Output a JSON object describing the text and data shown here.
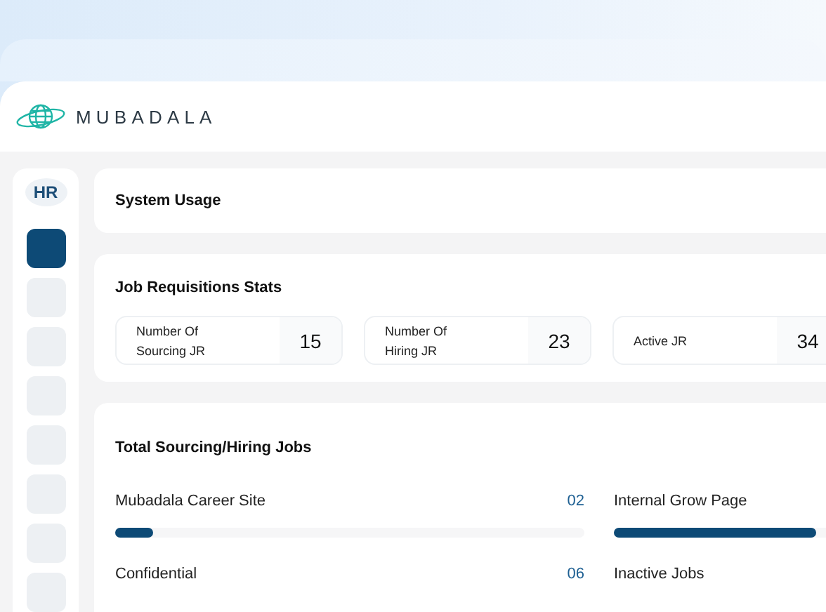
{
  "brand": {
    "name": "MUBADALA"
  },
  "sidebar": {
    "avatar": "HR",
    "items": [
      {
        "selected": true
      },
      {
        "selected": false
      },
      {
        "selected": false
      },
      {
        "selected": false
      },
      {
        "selected": false
      },
      {
        "selected": false
      },
      {
        "selected": false
      },
      {
        "selected": false
      }
    ]
  },
  "system_usage": {
    "title": "System Usage"
  },
  "job_requisitions": {
    "title": "Job Requisitions Stats",
    "stats": [
      {
        "label": "Number Of Sourcing JR",
        "value": "15"
      },
      {
        "label": "Number Of Hiring JR",
        "value": "23"
      },
      {
        "label": "Active JR",
        "value": "34"
      }
    ]
  },
  "jobs": {
    "title": "Total Sourcing/Hiring Jobs",
    "items": [
      {
        "label": "Mubadala Career Site",
        "count": "02",
        "level": 0.08
      },
      {
        "label": "Internal Grow Page",
        "level": 0.43
      },
      {
        "label": "Confidential",
        "count": "06"
      },
      {
        "label": "Inactive Jobs"
      }
    ]
  }
}
